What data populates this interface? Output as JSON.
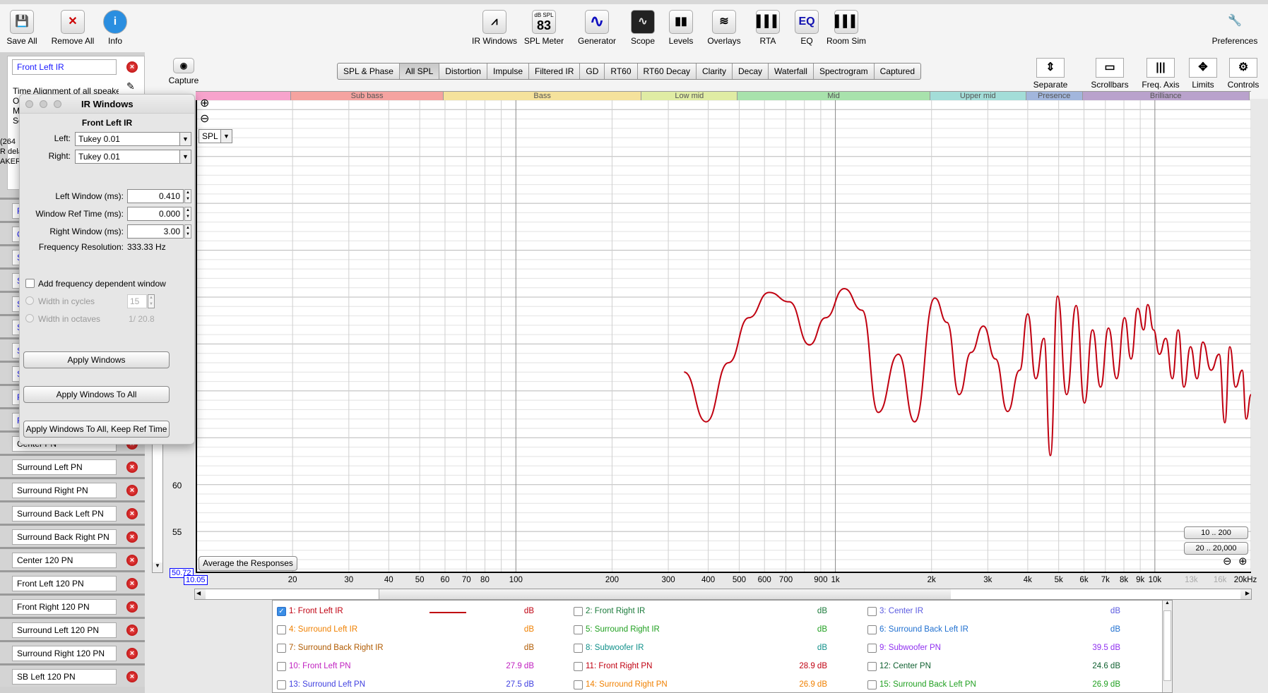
{
  "toolbar": {
    "left": [
      {
        "label": "Save All",
        "icon": "save-all-icon"
      },
      {
        "label": "Remove All",
        "icon": "remove-all-icon"
      },
      {
        "label": "Info",
        "icon": "info-icon"
      }
    ],
    "center": [
      {
        "label": "IR Windows",
        "icon": "ir-windows-icon",
        "glyph": "⩘"
      },
      {
        "label": "SPL Meter",
        "icon": "spl-meter-icon",
        "glyph": "83",
        "caption": "dB SPL"
      },
      {
        "label": "Generator",
        "icon": "generator-icon",
        "glyph": "∿"
      },
      {
        "label": "Scope",
        "icon": "scope-icon",
        "glyph": "∿"
      },
      {
        "label": "Levels",
        "icon": "levels-icon",
        "glyph": "▮▮"
      },
      {
        "label": "Overlays",
        "icon": "overlays-icon",
        "glyph": "≋"
      },
      {
        "label": "RTA",
        "icon": "rta-icon",
        "glyph": "▌▌▌"
      },
      {
        "label": "EQ",
        "icon": "eq-icon",
        "glyph": "EQ"
      },
      {
        "label": "Room Sim",
        "icon": "room-sim-icon",
        "glyph": "▌▌▌"
      }
    ],
    "preferences": "Preferences",
    "capture": "Capture",
    "right": [
      {
        "label": "Separate",
        "icon": "separate-icon",
        "glyph": "⇕"
      },
      {
        "label": "Scrollbars",
        "icon": "scrollbars-icon",
        "glyph": "▭"
      },
      {
        "label": "Freq. Axis",
        "icon": "freq-axis-icon",
        "glyph": "|||"
      },
      {
        "label": "Limits",
        "icon": "limits-icon",
        "glyph": "✥"
      },
      {
        "label": "Controls",
        "icon": "controls-icon",
        "glyph": "⚙"
      }
    ]
  },
  "tabs": [
    {
      "label": "SPL & Phase"
    },
    {
      "label": "All SPL",
      "active": true
    },
    {
      "label": "Distortion"
    },
    {
      "label": "Impulse"
    },
    {
      "label": "Filtered IR"
    },
    {
      "label": "GD"
    },
    {
      "label": "RT60"
    },
    {
      "label": "RT60 Decay"
    },
    {
      "label": "Clarity"
    },
    {
      "label": "Decay"
    },
    {
      "label": "Waterfall"
    },
    {
      "label": "Spectrogram"
    },
    {
      "label": "Captured"
    }
  ],
  "sidebar": {
    "selected_name": "Front Left IR",
    "notes": [
      "Time Alignment of all speake",
      "O",
      "M",
      "So"
    ],
    "fragments": [
      "(264",
      "R dela",
      "AKER"
    ],
    "hidden_items": [
      "F",
      "C",
      "S",
      "S",
      "S",
      "S",
      "S",
      "S",
      "F",
      "F"
    ],
    "items": [
      "Center PN",
      "Surround Left PN",
      "Surround Right PN",
      "Surround Back Left PN",
      "Surround Back Right PN",
      "Center 120 PN",
      "Front Left 120 PN",
      "Front Right 120 PN",
      "Surround Left 120 PN",
      "Surround Right 120 PN",
      "SB Left 120 PN"
    ]
  },
  "dialog": {
    "title": "IR Windows",
    "measurement": "Front Left IR",
    "left_label": "Left:",
    "left_value": "Tukey 0.01",
    "right_label": "Right:",
    "right_value": "Tukey 0.01",
    "left_window_label": "Left Window (ms):",
    "left_window": "0.410",
    "ref_time_label": "Window Ref Time (ms):",
    "ref_time": "0.000",
    "right_window_label": "Right Window (ms):",
    "right_window": "3.00",
    "freq_res_label": "Frequency Resolution:",
    "freq_res": "333.33 Hz",
    "fdw_label": "Add frequency dependent window",
    "fdw_checked": false,
    "cycles_label": "Width in cycles",
    "cycles_value": "15",
    "octaves_label": "Width in octaves",
    "octaves_value": "1/ 20.8",
    "apply": "Apply Windows",
    "apply_all": "Apply Windows To All",
    "apply_all_keep": "Apply Windows To All, Keep Ref Time"
  },
  "graph": {
    "unit_select": "SPL",
    "average_button": "Average the Responses",
    "range_btn_1": "10 .. 200",
    "range_btn_2": "20 .. 20,000",
    "y_min_readout": "50.72",
    "x_min_readout": "10.05",
    "bands": [
      {
        "label": "",
        "from": 10.05,
        "to": 20,
        "color": "#f7a3cc"
      },
      {
        "label": "Sub bass",
        "from": 20,
        "to": 60,
        "color": "#f5a3a0"
      },
      {
        "label": "Bass",
        "from": 60,
        "to": 250,
        "color": "#f5e29c"
      },
      {
        "label": "Low mid",
        "from": 250,
        "to": 500,
        "color": "#e0eca4"
      },
      {
        "label": "Mid",
        "from": 500,
        "to": 2000,
        "color": "#a8e2ac"
      },
      {
        "label": "Upper mid",
        "from": 2000,
        "to": 4000,
        "color": "#a3ddd8"
      },
      {
        "label": "Presence",
        "from": 4000,
        "to": 6000,
        "color": "#a2b6dc"
      },
      {
        "label": "Brilliance",
        "from": 6000,
        "to": 20000,
        "color": "#b9a2cc"
      }
    ]
  },
  "chart_data": {
    "type": "line",
    "xscale": "log",
    "xlim": [
      10.05,
      20000
    ],
    "ylim": [
      50.72,
      101
    ],
    "grid": true,
    "xticks": [
      {
        "v": 20,
        "label": "20"
      },
      {
        "v": 30,
        "label": "30"
      },
      {
        "v": 40,
        "label": "40"
      },
      {
        "v": 50,
        "label": "50"
      },
      {
        "v": 60,
        "label": "60"
      },
      {
        "v": 70,
        "label": "70"
      },
      {
        "v": 80,
        "label": "80"
      },
      {
        "v": 100,
        "label": "100"
      },
      {
        "v": 200,
        "label": "200"
      },
      {
        "v": 300,
        "label": "300"
      },
      {
        "v": 400,
        "label": "400"
      },
      {
        "v": 500,
        "label": "500"
      },
      {
        "v": 600,
        "label": "600"
      },
      {
        "v": 700,
        "label": "700"
      },
      {
        "v": 900,
        "label": "900"
      },
      {
        "v": 1000,
        "label": "1k"
      },
      {
        "v": 2000,
        "label": "2k"
      },
      {
        "v": 3000,
        "label": "3k"
      },
      {
        "v": 4000,
        "label": "4k"
      },
      {
        "v": 5000,
        "label": "5k"
      },
      {
        "v": 6000,
        "label": "6k"
      },
      {
        "v": 7000,
        "label": "7k"
      },
      {
        "v": 8000,
        "label": "8k"
      },
      {
        "v": 9000,
        "label": "9k"
      },
      {
        "v": 10000,
        "label": "10k"
      },
      {
        "v": 13000,
        "label": "13k",
        "dim": true
      },
      {
        "v": 16000,
        "label": "16k",
        "dim": true
      },
      {
        "v": 20000,
        "label": "20kHz"
      }
    ],
    "yticks": [
      {
        "v": 55,
        "label": "55"
      },
      {
        "v": 60,
        "label": "60"
      }
    ],
    "series": [
      {
        "name": "1: Front Left IR",
        "color": "#c00010",
        "x": [
          336,
          394,
          463,
          536,
          620,
          717,
          830,
          932,
          1066,
          1212,
          1362,
          1575,
          1770,
          2048,
          2236,
          2440,
          2660,
          2905,
          3170,
          3460,
          3775,
          4000,
          4240,
          4495,
          4710,
          4960,
          5295,
          5670,
          6020,
          6380,
          6760,
          7160,
          7590,
          8040,
          8420,
          8840,
          9220,
          9500,
          9905,
          10330,
          10820,
          11340,
          11830,
          12330,
          12930,
          13550,
          14130,
          14990,
          15890,
          16560,
          17160,
          17890,
          18760,
          19320,
          20000
        ],
        "y": [
          72.0,
          66.7,
          73.0,
          77.8,
          80.5,
          79.5,
          74.9,
          77.8,
          80.9,
          78.6,
          67.7,
          73.9,
          66.7,
          79.9,
          77.3,
          69.6,
          74.1,
          76.9,
          73.4,
          67.8,
          72.2,
          78.2,
          71.3,
          75.6,
          63.1,
          80.1,
          69.6,
          79.1,
          68.7,
          76.5,
          70.4,
          76.7,
          71.3,
          77.8,
          73.4,
          78.8,
          76.5,
          79.2,
          76.5,
          73.9,
          75.6,
          71.3,
          76.5,
          70.4,
          74.7,
          71.3,
          75.2,
          72.2,
          73.9,
          66.6,
          74.7,
          70.4,
          72.2,
          67.0,
          69.6
        ]
      }
    ]
  },
  "legend": [
    {
      "label": "1: Front Left IR",
      "value": "dB",
      "color": "#c00010",
      "checked": true
    },
    {
      "label": "2: Front Right IR",
      "value": "dB",
      "color": "#1a7a3a"
    },
    {
      "label": "3: Center IR",
      "value": "dB",
      "color": "#5a5ae0"
    },
    {
      "label": "4: Surround Left IR",
      "value": "dB",
      "color": "#f08000"
    },
    {
      "label": "5: Surround Right IR",
      "value": "dB",
      "color": "#20a020"
    },
    {
      "label": "6: Surround Back Left IR",
      "value": "dB",
      "color": "#2070d0"
    },
    {
      "label": "7: Surround Back Right IR",
      "value": "dB",
      "color": "#b05a00"
    },
    {
      "label": "8: Subwoofer IR",
      "value": "dB",
      "color": "#10908a"
    },
    {
      "label": "9: Subwoofer PN",
      "value": "39.5 dB",
      "color": "#9030f0"
    },
    {
      "label": "10: Front Left PN",
      "value": "27.9 dB",
      "color": "#c020c0"
    },
    {
      "label": "11: Front Right PN",
      "value": "28.9 dB",
      "color": "#c00010"
    },
    {
      "label": "12: Center PN",
      "value": "24.6 dB",
      "color": "#106030"
    },
    {
      "label": "13: Surround Left PN",
      "value": "27.5 dB",
      "color": "#4040e0"
    },
    {
      "label": "14: Surround Right PN",
      "value": "26.9 dB",
      "color": "#f08000"
    },
    {
      "label": "15: Surround Back Left PN",
      "value": "26.9 dB",
      "color": "#20a020"
    }
  ]
}
